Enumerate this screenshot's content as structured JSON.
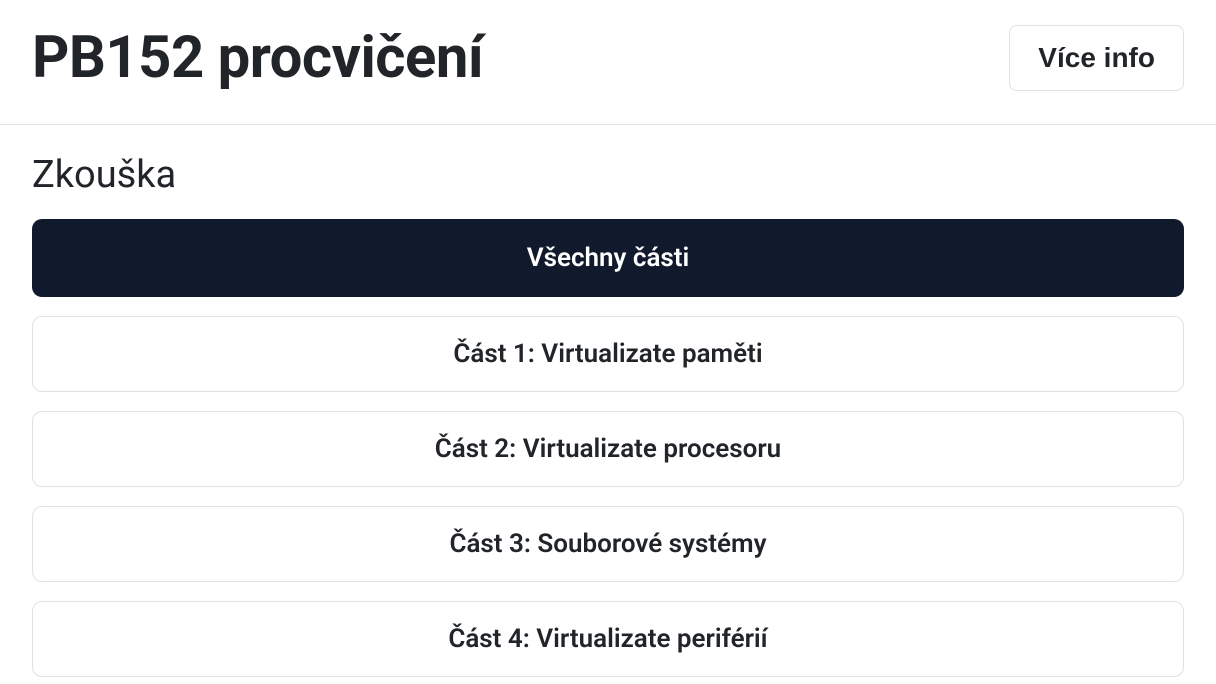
{
  "header": {
    "title": "PB152 procvičení",
    "moreInfoLabel": "Více info"
  },
  "section": {
    "title": "Zkouška"
  },
  "items": [
    {
      "label": "Všechny části",
      "active": true
    },
    {
      "label": "Část 1: Virtualizate paměti",
      "active": false
    },
    {
      "label": "Část 2: Virtualizate procesoru",
      "active": false
    },
    {
      "label": "Část 3: Souborové systémy",
      "active": false
    },
    {
      "label": "Část 4: Virtualizate periférií",
      "active": false
    }
  ]
}
